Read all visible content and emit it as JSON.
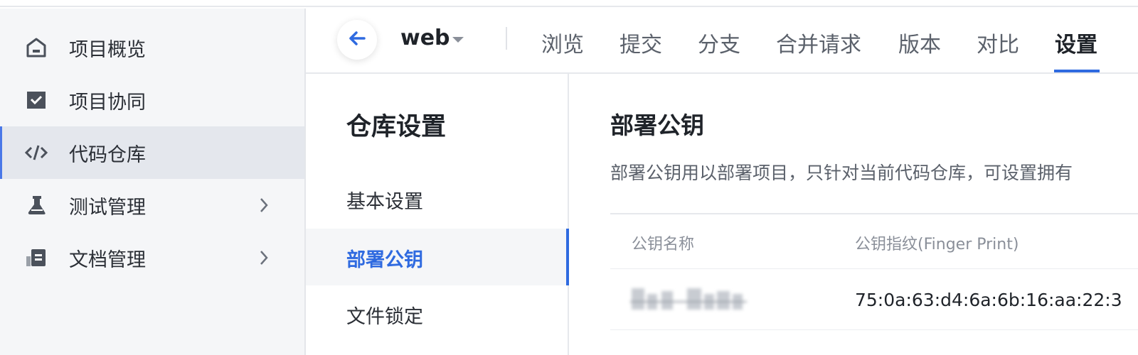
{
  "sidebar": {
    "items": [
      {
        "label": "项目概览",
        "icon": "home-icon",
        "has_chevron": false,
        "active": false
      },
      {
        "label": "项目协同",
        "icon": "check-board-icon",
        "has_chevron": false,
        "active": false
      },
      {
        "label": "代码仓库",
        "icon": "code-icon",
        "has_chevron": false,
        "active": true
      },
      {
        "label": "测试管理",
        "icon": "flask-icon",
        "has_chevron": true,
        "active": false
      },
      {
        "label": "文档管理",
        "icon": "document-icon",
        "has_chevron": true,
        "active": false
      }
    ]
  },
  "header": {
    "back_icon": "arrow-left-icon",
    "repo_name": "web",
    "tabs": [
      {
        "label": "浏览",
        "active": false
      },
      {
        "label": "提交",
        "active": false
      },
      {
        "label": "分支",
        "active": false
      },
      {
        "label": "合并请求",
        "active": false
      },
      {
        "label": "版本",
        "active": false
      },
      {
        "label": "对比",
        "active": false
      },
      {
        "label": "设置",
        "active": true
      }
    ]
  },
  "submenu": {
    "title": "仓库设置",
    "items": [
      {
        "label": "基本设置",
        "active": false
      },
      {
        "label": "部署公钥",
        "active": true
      },
      {
        "label": "文件锁定",
        "active": false
      }
    ]
  },
  "content": {
    "title": "部署公钥",
    "description": "部署公钥用以部署项目，只针对当前代码仓库，可设置拥有",
    "table": {
      "columns": [
        "公钥名称",
        "公钥指纹(Finger Print)"
      ],
      "rows": [
        {
          "name_redacted": true,
          "fingerprint": "75:0a:63:d4:6a:6b:16:aa:22:3"
        }
      ]
    }
  },
  "colors": {
    "accent": "#2f6ae0",
    "sidebar_bg": "#f5f6f8",
    "active_bg": "#e4e7ed"
  }
}
